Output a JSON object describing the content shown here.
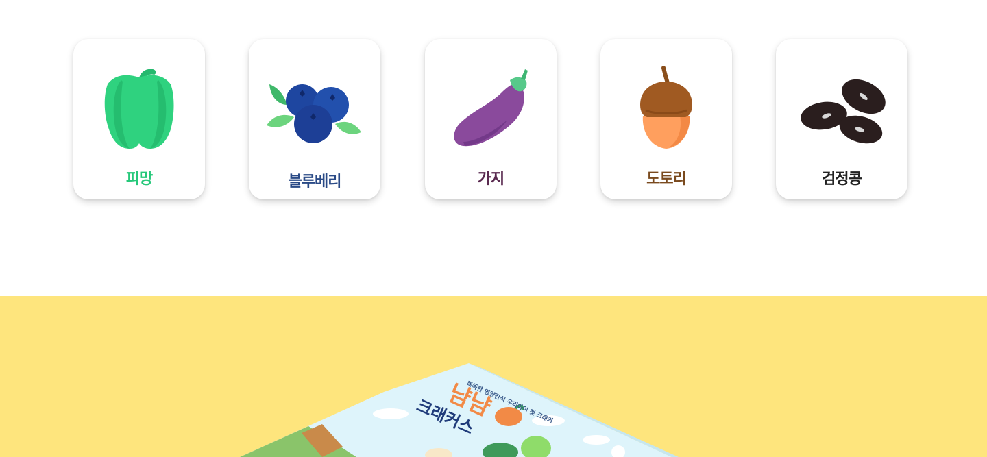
{
  "cards": [
    {
      "label": "피망",
      "icon": "bell-pepper-icon",
      "color": "#26c87a"
    },
    {
      "label": "블루베리",
      "icon": "blueberry-icon",
      "color": "#2a4a86"
    },
    {
      "label": "가지",
      "icon": "eggplant-icon",
      "color": "#5a2a50"
    },
    {
      "label": "도토리",
      "icon": "acorn-icon",
      "color": "#7a4a1e"
    },
    {
      "label": "검정콩",
      "icon": "black-bean-icon",
      "color": "#222222"
    }
  ],
  "product": {
    "tagline": "똑똑한 영양간식 우리아이 첫 크래커",
    "brand_line1": "냠냠",
    "brand_line2": "크래커스"
  },
  "colors": {
    "banner_bg": "#fee57d",
    "box_sky": "#def4fb",
    "brand_orange": "#f28a46",
    "brand_navy": "#1f3b7a"
  }
}
